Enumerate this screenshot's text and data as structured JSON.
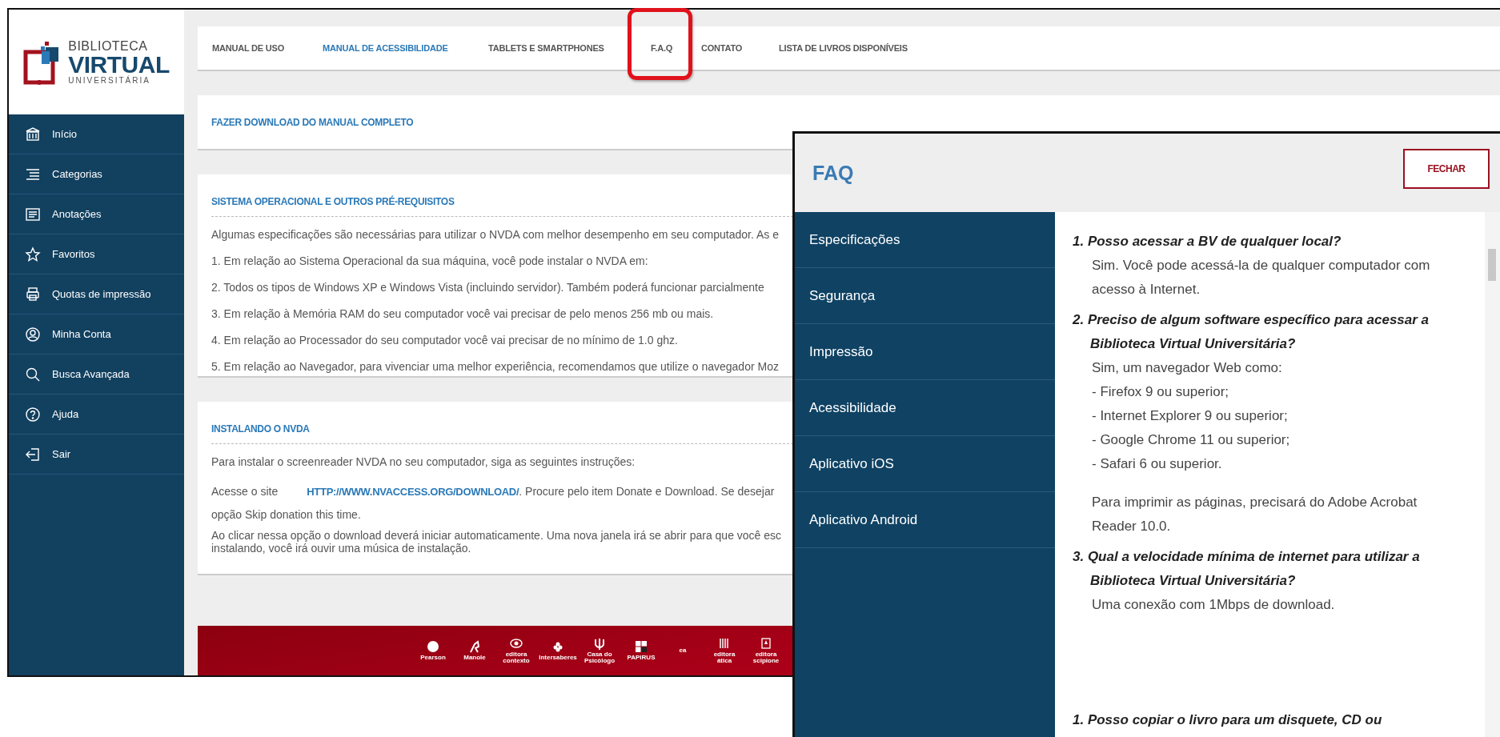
{
  "logo": {
    "line_1": "BIBLIOTECA",
    "line_2": "VIRTUAL",
    "line_3": "UNIVERSITÁRIA"
  },
  "sidebar": {
    "items": [
      {
        "label": "Início"
      },
      {
        "label": "Categorias"
      },
      {
        "label": "Anotações"
      },
      {
        "label": "Favoritos"
      },
      {
        "label": "Quotas de impressão"
      },
      {
        "label": "Minha Conta"
      },
      {
        "label": "Busca Avançada"
      },
      {
        "label": "Ajuda"
      },
      {
        "label": "Sair"
      }
    ]
  },
  "top_nav": [
    {
      "label": "MANUAL DE USO",
      "selected": false
    },
    {
      "label": "MANUAL DE ACESSIBILIDADE",
      "selected": true
    },
    {
      "label": "TABLETS E SMARTPHONES",
      "selected": false
    },
    {
      "label": "F.A.Q",
      "selected": false
    },
    {
      "label": "CONTATO",
      "selected": false
    },
    {
      "label": "LISTA DE LIVROS DISPONÍVEIS",
      "selected": false
    }
  ],
  "download_link": "FAZER DOWNLOAD DO MANUAL COMPLETO",
  "requirements": {
    "title": "SISTEMA OPERACIONAL E OUTROS PRÉ-REQUISITOS",
    "lines": [
      "Algumas especificações são necessárias para utilizar o NVDA com melhor desempenho em seu computador. As e",
      "1. Em relação ao Sistema Operacional da sua máquina, você pode instalar o NVDA em:",
      "2. Todos os tipos de Windows XP e Windows Vista (incluindo servidor). Também poderá funcionar parcialmente",
      "3. Em relação à Memória RAM do seu computador você vai precisar de pelo menos 256 mb ou mais.",
      "4. Em relação ao Processador do seu computador você vai precisar de no mínimo de 1.0 ghz.",
      "5. Em relação ao Navegador, para vivenciar uma melhor experiência, recomendamos que utilize o navegador Moz"
    ]
  },
  "install": {
    "title": "INSTALANDO O NVDA",
    "intro": "Para instalar o screenreader NVDA no seu computador, siga as seguintes instruções:",
    "site_label": "Acesse o site",
    "site_link": "HTTP://WWW.NVACCESS.ORG/DOWNLOAD/",
    "site_rest": ". Procure pelo item Donate e Download. Se desejar",
    "skip_line": "opção Skip donation this time.",
    "final_lines": [
      "Ao clicar nessa opção o download deverá iniciar automaticamente. Uma nova janela irá se abrir para que você esc",
      "instalando, você irá ouvir uma música de instalação."
    ]
  },
  "footer": {
    "logos": [
      "Pearson",
      "Manole",
      "editora contexto",
      "Intersaberes",
      "Casa do Psicólogo",
      "PAPIRUS",
      "ea",
      "editora ática",
      "editora scipione"
    ]
  },
  "faq": {
    "title": "FAQ",
    "close_label": "FECHAR",
    "menu": [
      "Especificações",
      "Segurança",
      "Impressão",
      "Acessibilidade",
      "Aplicativo iOS",
      "Aplicativo Android"
    ],
    "questions": [
      {
        "question": "1. Posso acessar a BV de qualquer local?",
        "answer": [
          {
            "kind": "line",
            "text": "Sim. Você pode acessá-la de qualquer computador com acesso à Internet."
          }
        ]
      },
      {
        "question": "2. Preciso de algum software específico para acessar a Biblioteca Virtual Universitária?",
        "answer": [
          {
            "kind": "line",
            "text": "Sim, um navegador Web como:"
          },
          {
            "kind": "line",
            "text": "- Firefox 9 ou superior;"
          },
          {
            "kind": "line",
            "text": "- Internet Explorer 9 ou superior;"
          },
          {
            "kind": "line",
            "text": "- Google Chrome 11 ou superior;"
          },
          {
            "kind": "line",
            "text": "- Safari 6 ou superior."
          },
          {
            "kind": "note",
            "text": "Para imprimir as páginas, precisará do Adobe Acrobat Reader 10.0."
          }
        ]
      },
      {
        "question": "3. Qual a velocidade mínima de internet para utilizar a Biblioteca Virtual Universitária?",
        "answer": [
          {
            "kind": "line",
            "text": "Uma conexão com 1Mbps de download."
          }
        ]
      }
    ],
    "next_question": "1. Posso copiar o livro para um disquete, CD ou"
  }
}
